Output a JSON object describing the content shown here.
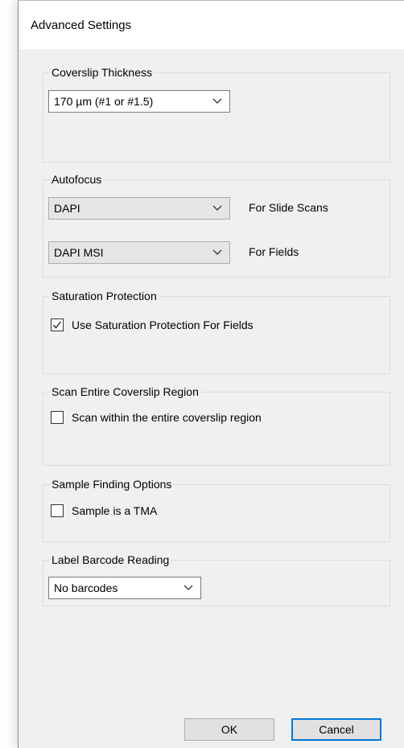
{
  "window": {
    "title": "Advanced Settings"
  },
  "coverslip": {
    "legend": "Coverslip Thickness",
    "selected": "170 µm (#1 or #1.5)"
  },
  "autofocus": {
    "legend": "Autofocus",
    "slide_scans": {
      "selected": "DAPI",
      "label": "For Slide Scans"
    },
    "fields": {
      "selected": "DAPI MSI",
      "label": "For Fields"
    }
  },
  "saturation": {
    "legend": "Saturation Protection",
    "checkbox_label": "Use Saturation Protection For Fields",
    "checked": true
  },
  "scan_entire": {
    "legend": "Scan Entire Coverslip Region",
    "checkbox_label": "Scan within the entire coverslip region",
    "checked": false
  },
  "sample_finding": {
    "legend": "Sample Finding Options",
    "checkbox_label": "Sample is a TMA",
    "checked": false
  },
  "barcode": {
    "legend": "Label Barcode Reading",
    "selected": "No barcodes"
  },
  "buttons": {
    "ok": "OK",
    "cancel": "Cancel"
  },
  "icons": {
    "dropdown": "chevron-down-icon",
    "check": "checkmark-icon"
  },
  "colors": {
    "accent": "#0078d7",
    "dialog_bg": "#f0f0f0"
  }
}
